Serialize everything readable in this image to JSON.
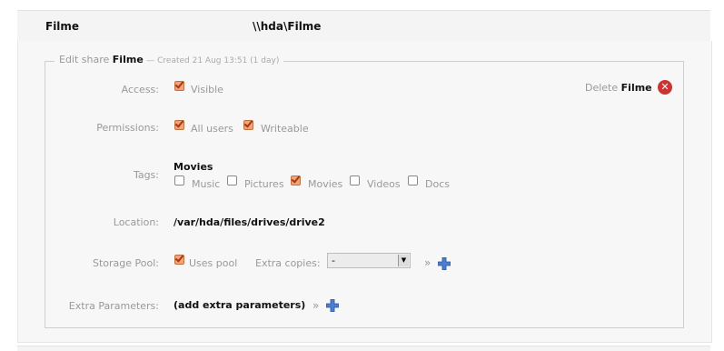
{
  "share": {
    "name": "Filme",
    "path": "\\\\hda\\Filme"
  },
  "legend": {
    "prefix": "Edit share",
    "name": "Filme",
    "created": "— Created 21 Aug 13:51 (1 day)"
  },
  "delete": {
    "prefix": "Delete",
    "name": "Filme"
  },
  "access": {
    "label": "Access:",
    "options": [
      {
        "label": "Visible",
        "checked": true
      }
    ]
  },
  "permissions": {
    "label": "Permissions:",
    "options": [
      {
        "label": "All users",
        "checked": true
      },
      {
        "label": "Writeable",
        "checked": true
      }
    ]
  },
  "tags": {
    "label": "Tags:",
    "current": "Movies",
    "options": [
      {
        "label": "Music",
        "checked": false
      },
      {
        "label": "Pictures",
        "checked": false
      },
      {
        "label": "Movies",
        "checked": true
      },
      {
        "label": "Videos",
        "checked": false
      },
      {
        "label": "Docs",
        "checked": false
      }
    ]
  },
  "location": {
    "label": "Location:",
    "value": "/var/hda/files/drives/drive2"
  },
  "storage_pool": {
    "label": "Storage Pool:",
    "uses_pool_label": "Uses pool",
    "uses_pool_checked": true,
    "extra_copies_label": "Extra copies:",
    "extra_copies_value": "-",
    "raquo": "»"
  },
  "extra_params": {
    "label": "Extra Parameters:",
    "value": "(add extra parameters)",
    "raquo": "»"
  },
  "icons": {
    "delete": "delete-icon",
    "add": "plus-icon",
    "select_arrow": "chevron-down-icon"
  },
  "colors": {
    "checked_fill": "#f2a37c",
    "delete_red": "#cc3333",
    "plus_blue": "#4d7fd1"
  }
}
